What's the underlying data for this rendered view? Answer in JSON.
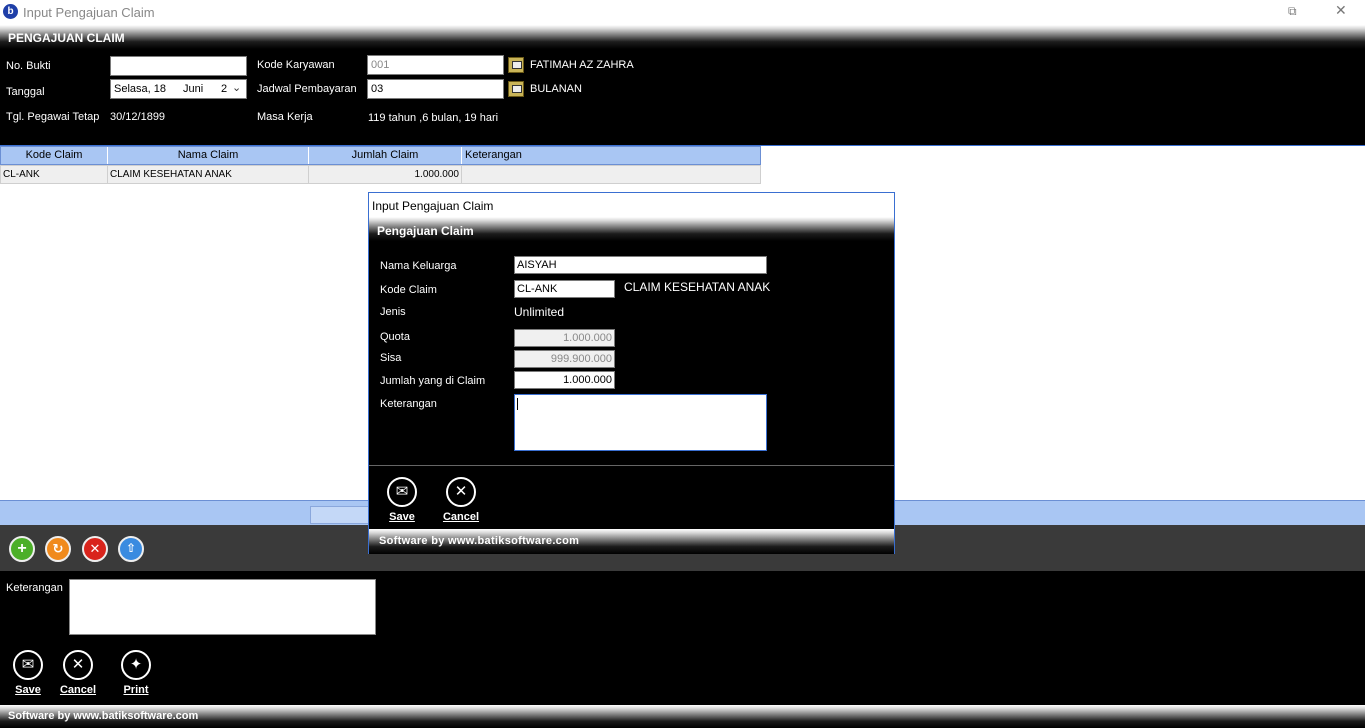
{
  "window": {
    "title": "Input Pengajuan Claim"
  },
  "header": {
    "label": "PENGAJUAN CLAIM"
  },
  "form": {
    "no_bukti_label": "No. Bukti",
    "no_bukti_value": "",
    "tanggal_label": "Tanggal",
    "tanggal_day": "Selasa, 18",
    "tanggal_month": "Juni",
    "tanggal_year": "2",
    "tgl_pegawai_label": "Tgl. Pegawai Tetap",
    "tgl_pegawai_value": "30/12/1899",
    "kode_karyawan_label": "Kode Karyawan",
    "kode_karyawan_value": "001",
    "karyawan_name": "FATIMAH AZ ZAHRA",
    "jadwal_label": "Jadwal Pembayaran",
    "jadwal_value": "03",
    "jadwal_name": "BULANAN",
    "masa_kerja_label": "Masa Kerja",
    "masa_kerja_value": "119 tahun ,6 bulan, 19 hari"
  },
  "grid": {
    "columns": [
      "Kode Claim",
      "Nama Claim",
      "Jumlah Claim",
      "Keterangan"
    ],
    "rows": [
      {
        "kode": "CL-ANK",
        "nama": "CLAIM KESEHATAN ANAK",
        "jumlah": "1.000.000",
        "keterangan": ""
      }
    ]
  },
  "bottom": {
    "keterangan_label": "Keterangan",
    "save_label": "Save",
    "cancel_label": "Cancel",
    "print_label": "Print"
  },
  "footer": {
    "text": "Software by www.batiksoftware.com"
  },
  "dialog": {
    "title": "Input Pengajuan Claim",
    "band_label": "Pengajuan Claim",
    "nama_keluarga_label": "Nama Keluarga",
    "nama_keluarga_value": "AISYAH",
    "kode_claim_label": "Kode Claim",
    "kode_claim_value": "CL-ANK",
    "kode_claim_name": "CLAIM KESEHATAN ANAK",
    "jenis_label": "Jenis",
    "jenis_value": "Unlimited",
    "quota_label": "Quota",
    "quota_value": "1.000.000",
    "sisa_label": "Sisa",
    "sisa_value": "999.900.000",
    "jumlah_label": "Jumlah yang di Claim",
    "jumlah_value": "1.000.000",
    "keterangan_label": "Keterangan",
    "save_label": "Save",
    "cancel_label": "Cancel",
    "footer_text": "Software by www.batiksoftware.com"
  }
}
